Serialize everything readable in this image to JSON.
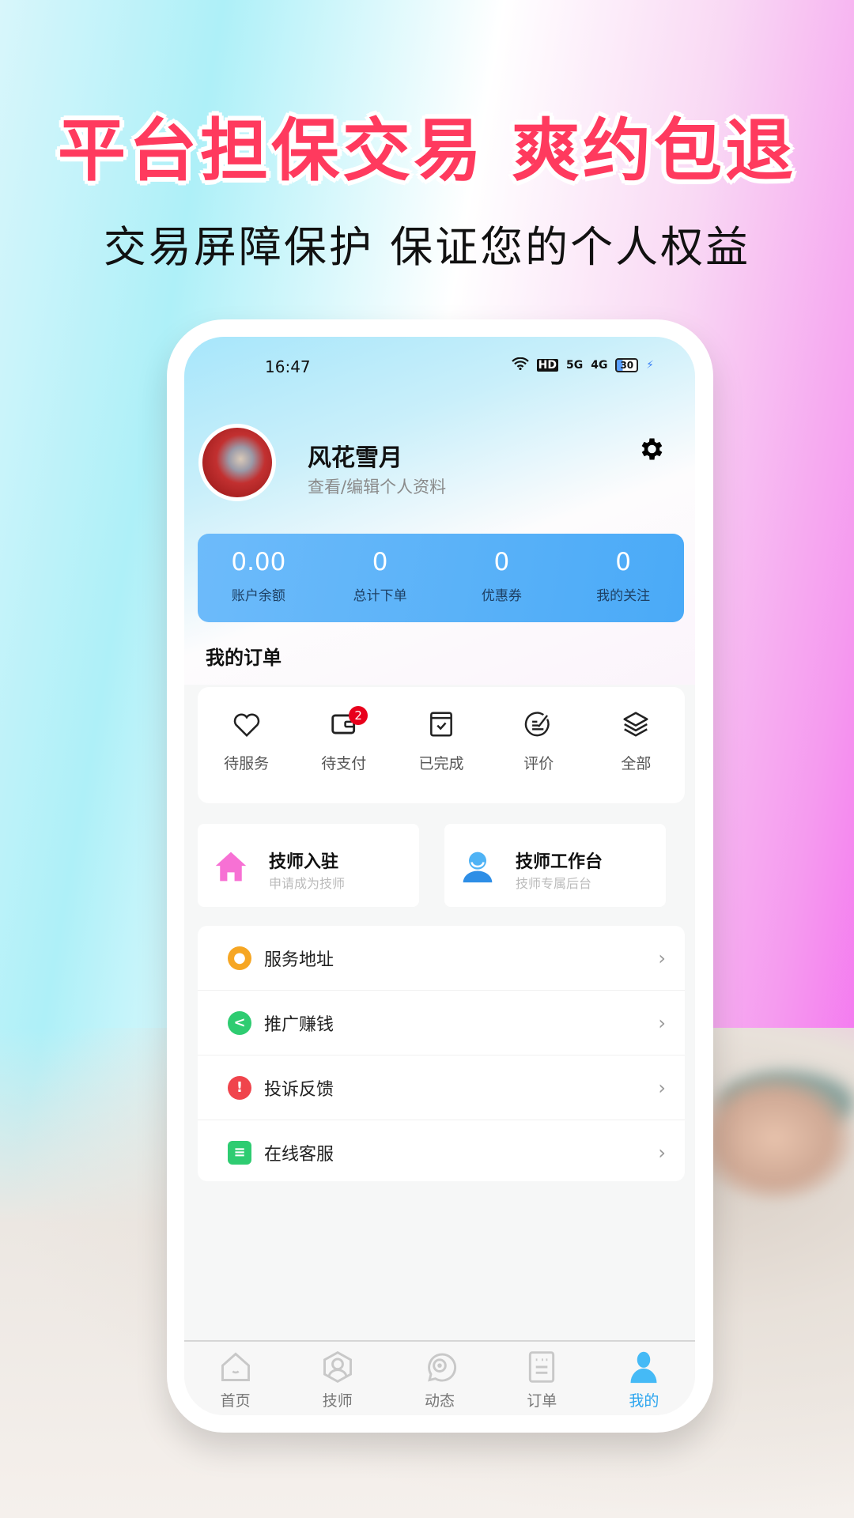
{
  "promo": {
    "headline": "平台担保交易 爽约包退",
    "subline": "交易屏障保护 保证您的个人权益"
  },
  "status_bar": {
    "time": "16:47",
    "wifi": "wifi-icon",
    "hd": "HD",
    "net1": "5G",
    "net2": "4G",
    "battery": "30"
  },
  "profile": {
    "name": "风花雪月",
    "edit_link": "查看/编辑个人资料",
    "settings_icon": "gear-icon"
  },
  "stats": [
    {
      "value": "0.00",
      "label": "账户余额"
    },
    {
      "value": "0",
      "label": "总计下单"
    },
    {
      "value": "0",
      "label": "优惠券"
    },
    {
      "value": "0",
      "label": "我的关注"
    }
  ],
  "orders": {
    "title": "我的订单",
    "items": [
      {
        "label": "待服务",
        "icon": "heart-icon"
      },
      {
        "label": "待支付",
        "icon": "wallet-icon",
        "badge": "2"
      },
      {
        "label": "已完成",
        "icon": "calendar-check-icon"
      },
      {
        "label": "评价",
        "icon": "review-icon"
      },
      {
        "label": "全部",
        "icon": "layers-icon"
      }
    ]
  },
  "cards": [
    {
      "title": "技师入驻",
      "subtitle": "申请成为技师",
      "icon": "house-icon"
    },
    {
      "title": "技师工作台",
      "subtitle": "技师专属后台",
      "icon": "person-icon"
    }
  ],
  "menu": [
    {
      "label": "服务地址",
      "icon": "location-icon",
      "color": "#f6a623"
    },
    {
      "label": "推广赚钱",
      "icon": "share-icon",
      "color": "#2ecc71"
    },
    {
      "label": "投诉反馈",
      "icon": "alert-icon",
      "color": "#f0444c"
    },
    {
      "label": "在线客服",
      "icon": "chat-icon",
      "color": "#2ecc71"
    }
  ],
  "tabbar": {
    "active_color": "#2ba5ef",
    "items": [
      {
        "label": "首页",
        "icon": "home-icon"
      },
      {
        "label": "技师",
        "icon": "technician-icon"
      },
      {
        "label": "动态",
        "icon": "feed-icon"
      },
      {
        "label": "订单",
        "icon": "order-icon"
      },
      {
        "label": "我的",
        "icon": "profile-icon",
        "active": true
      }
    ]
  }
}
